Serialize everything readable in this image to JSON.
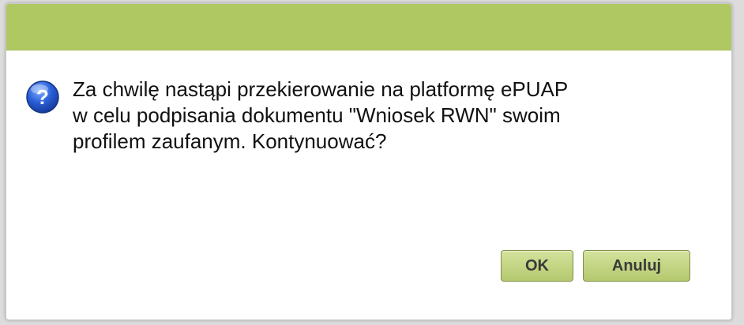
{
  "dialog": {
    "message": "Za chwilę nastąpi przekierowanie na platformę ePUAP\nw celu podpisania dokumentu \"Wniosek RWN\" swoim\nprofilem zaufanym. Kontynuować?",
    "icon": "question-icon",
    "buttons": {
      "ok_label": "OK",
      "cancel_label": "Anuluj"
    }
  },
  "colors": {
    "title_bar": "#b0c862",
    "button_top": "#d3e29c",
    "button_bottom": "#b5c96e",
    "icon_blue": "#2a5ed8"
  }
}
